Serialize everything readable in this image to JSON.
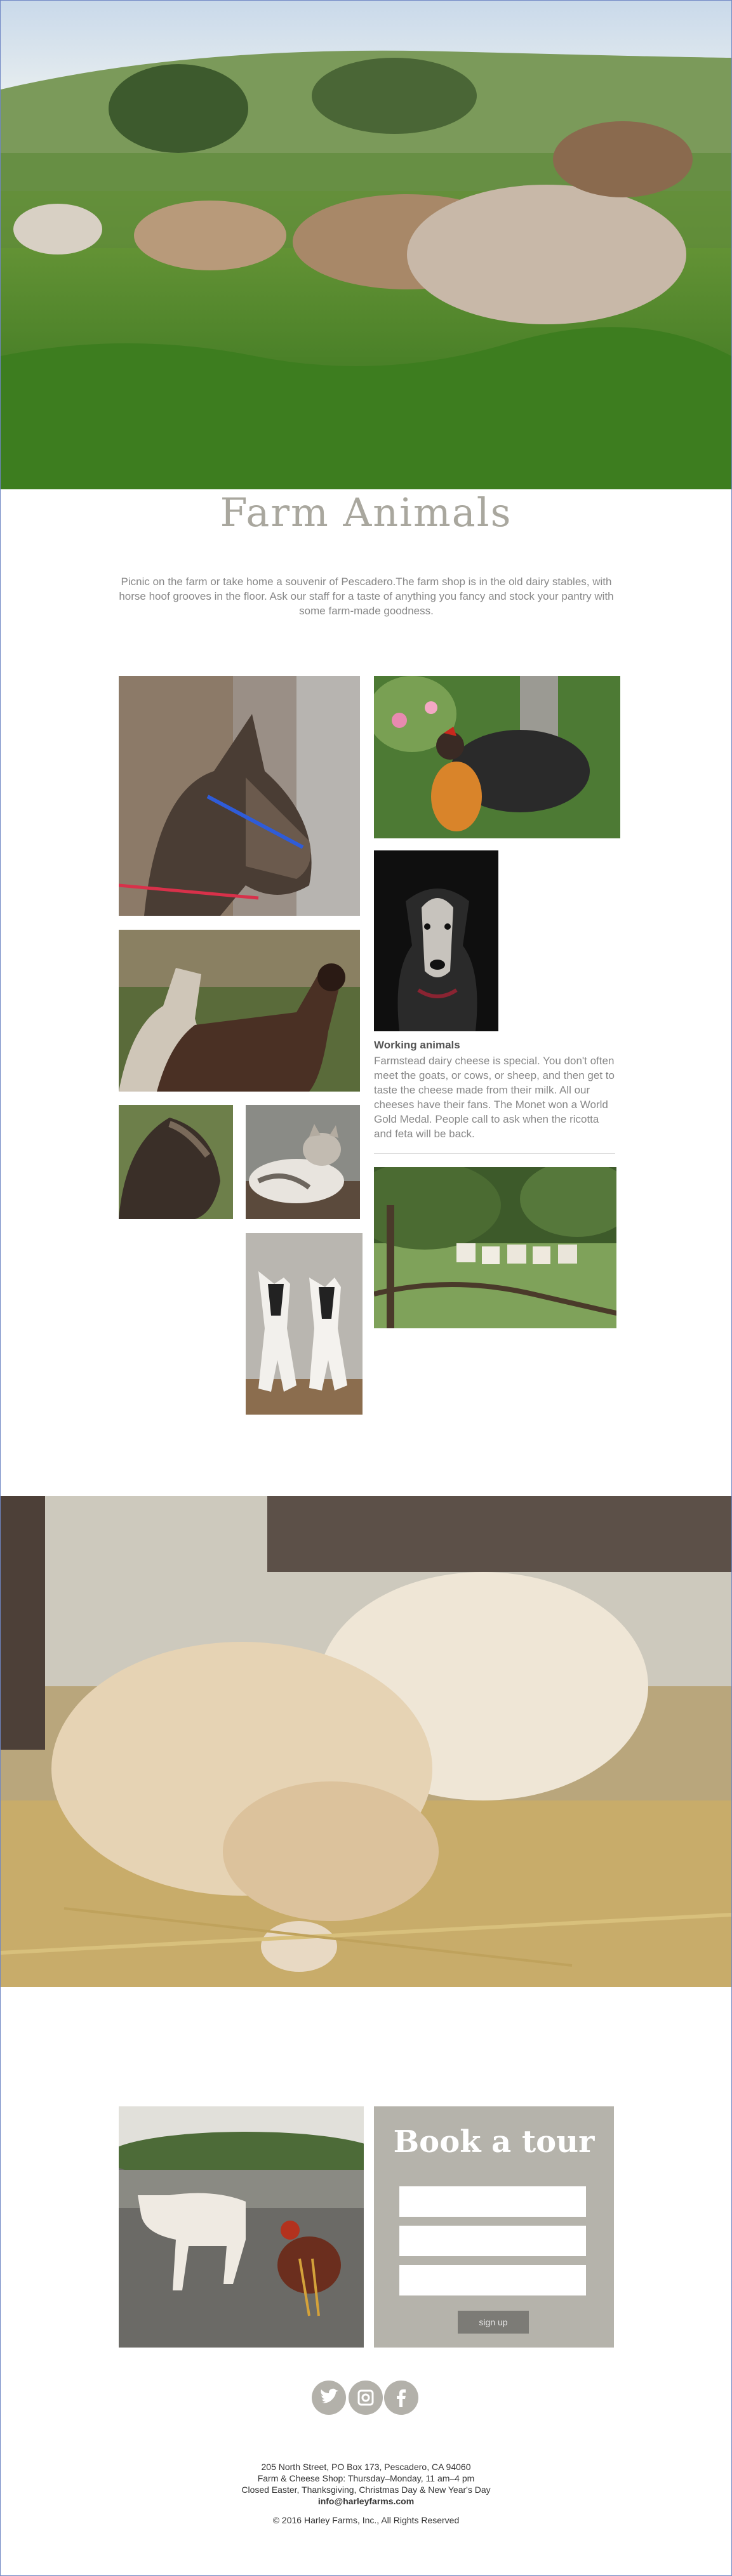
{
  "hero": {
    "icon": "goats-grazing-photo"
  },
  "section": {
    "title": "Farm Animals",
    "intro": "Picnic on the farm or take home a souvenir of Pescadero.The farm shop is in the old dairy stables, with horse hoof grooves in the floor. Ask our staff for a taste of anything you fancy and stock your pantry with some farm-made goodness."
  },
  "gallery": {
    "photos": [
      "donkey-photo",
      "hen-photo",
      "dog-photo",
      "llamas-photo",
      "llama-closeup-photo",
      "cat-photo",
      "baby-goats-photo",
      "beehives-photo"
    ]
  },
  "working": {
    "title": "Working animals",
    "text": "Farmstead dairy cheese is special. You don't often meet the goats, or cows, or sheep, and then get to taste the cheese made from their milk. All our cheeses have their fans. The Monet won a World Gold Medal. People call to ask when the ricotta and feta will be back."
  },
  "puppies": {
    "icon": "sleeping-puppies-photo"
  },
  "booking": {
    "title": "Book a tour",
    "field1_placeholder": "",
    "field2_placeholder": "",
    "field3_placeholder": "",
    "button_label": "sign up"
  },
  "social": [
    "twitter-icon",
    "instagram-icon",
    "facebook-icon"
  ],
  "footer": {
    "address": "205 North Street, PO Box 173, Pescadero, CA 94060",
    "hours": "Farm & Cheese Shop: Thursday–Monday, 11 am–4 pm",
    "closed": "Closed Easter, Thanksgiving, Christmas Day & New Year's Day",
    "email": "info@harleyfarms.com",
    "copyright": "© 2016 Harley Farms, Inc., All Rights Reserved"
  },
  "colors": {
    "accent_gray": "#b5b3ab",
    "button": "#7c7b76",
    "border": "#6f86c4"
  }
}
